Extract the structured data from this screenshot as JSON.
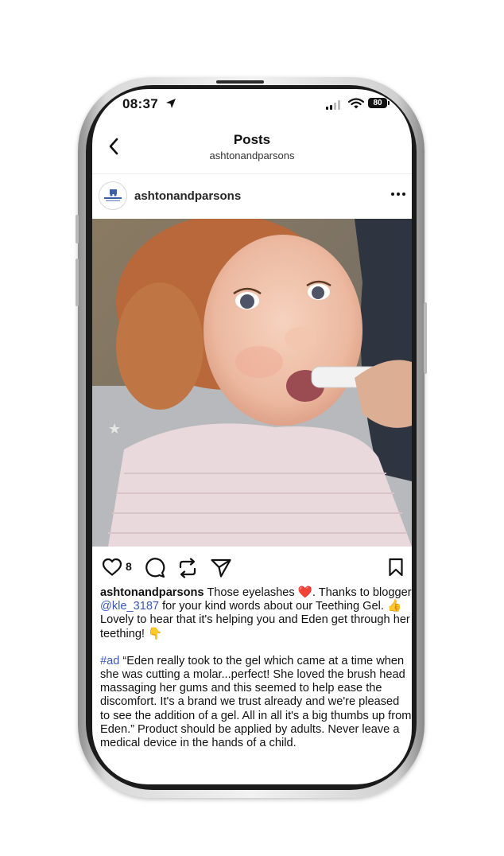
{
  "status_bar": {
    "time": "08:37",
    "battery": "80"
  },
  "header": {
    "title": "Posts",
    "subtitle": "ashtonandparsons"
  },
  "post": {
    "username": "ashtonandparsons",
    "avatar_brand": "Ashton & Parsons",
    "likes": "8",
    "caption": {
      "author": "ashtonandparsons",
      "part1": " Those eyelashes ",
      "emoji_heart": "❤️",
      "part2": ". Thanks to blogger ",
      "mention": "@kle_3187",
      "part3": " for your kind words about our Teething Gel. ",
      "emoji_thumbs": "👍",
      "part4": " Lovely to hear that it's helping you and Eden get through her teething! ",
      "emoji_point": "👇",
      "hashtag": "#ad",
      "quote": " “Eden really took to the gel which came at a time when she was cutting a molar...perfect! She loved the brush head massaging her gums and this seemed to help ease the discomfort. It's a brand we trust already and we're pleased to see the addition of a gel. All in all it's a big thumbs up from Eden.” Product should be applied by adults. Never leave a medical device in the hands of a child."
    }
  },
  "icons": [
    "back-chevron-icon",
    "location-arrow-icon",
    "signal-icon",
    "wifi-icon",
    "battery-icon",
    "more-icon",
    "heart-icon",
    "comment-icon",
    "repost-icon",
    "share-icon",
    "bookmark-icon"
  ]
}
